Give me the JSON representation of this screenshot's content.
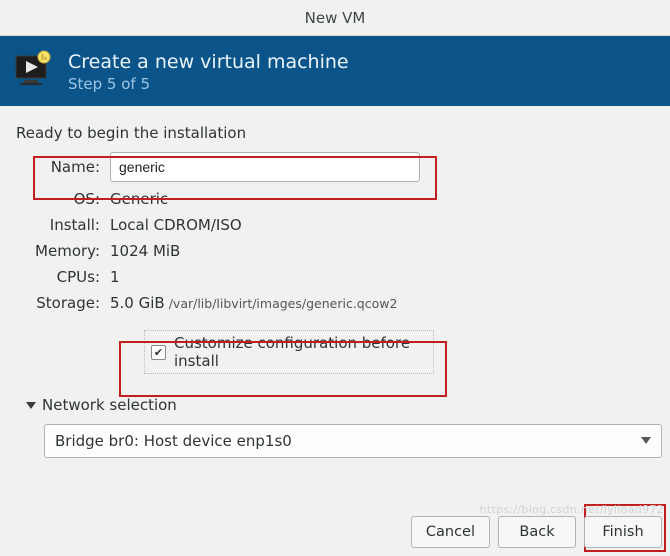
{
  "window": {
    "title": "New VM"
  },
  "header": {
    "title": "Create a new virtual machine",
    "step": "Step 5 of 5"
  },
  "content": {
    "ready": "Ready to begin the installation",
    "labels": {
      "name": "Name:",
      "os": "OS:",
      "install": "Install:",
      "memory": "Memory:",
      "cpus": "CPUs:",
      "storage": "Storage:"
    },
    "values": {
      "name": "generic",
      "os": "Generic",
      "install": "Local CDROM/ISO",
      "memory": "1024 MiB",
      "cpus": "1",
      "storage_size": "5.0 GiB",
      "storage_path": "/var/lib/libvirt/images/generic.qcow2"
    },
    "customize": {
      "checked": true,
      "label": "Customize configuration before install"
    },
    "network": {
      "section_label": "Network selection",
      "selected": "Bridge br0: Host device enp1s0"
    }
  },
  "buttons": {
    "cancel": "Cancel",
    "back": "Back",
    "finish": "Finish"
  },
  "watermark": "https://blog.csdn.net/lylload972"
}
